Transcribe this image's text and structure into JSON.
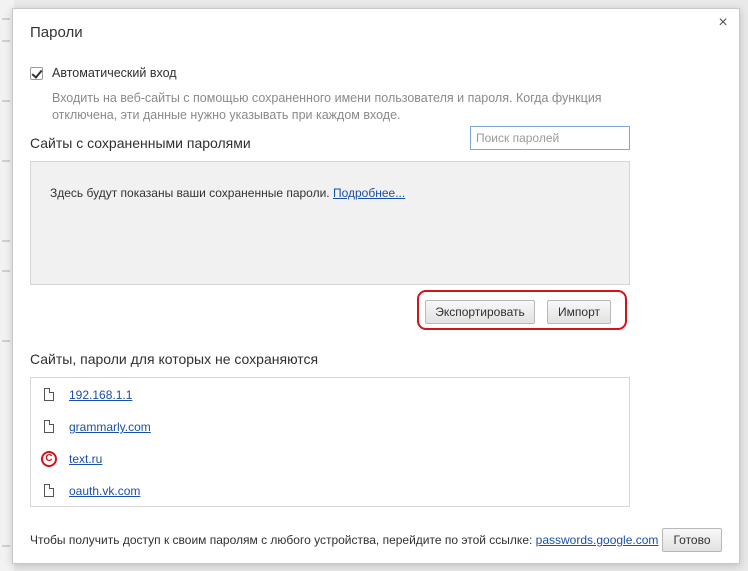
{
  "dialog": {
    "title": "Пароли",
    "close_glyph": "×"
  },
  "autologin": {
    "label": "Автоматический вход",
    "checked": true,
    "description": "Входить на веб-сайты с помощью сохраненного имени пользователя и пароля. Когда функция отключена, эти данные нужно указывать при каждом входе."
  },
  "saved": {
    "title": "Сайты с сохраненными паролями",
    "search_placeholder": "Поиск паролей",
    "empty_text": "Здесь будут показаны ваши сохраненные пароли.",
    "more_link": "Подробнее..."
  },
  "buttons": {
    "export": "Экспортировать",
    "import": "Импорт",
    "done": "Готово"
  },
  "highlight_color": "#d0141c",
  "exceptions": {
    "title": "Сайты, пароли для которых не сохраняются",
    "items": [
      {
        "site": "192.168.1.1",
        "icon": "page-icon"
      },
      {
        "site": "grammarly.com",
        "icon": "page-icon"
      },
      {
        "site": "text.ru",
        "icon": "copyright-icon"
      },
      {
        "site": "oauth.vk.com",
        "icon": "page-icon"
      }
    ]
  },
  "footer": {
    "text": "Чтобы получить доступ к своим паролям с любого устройства, перейдите по этой ссылке:",
    "link": "passwords.google.com"
  }
}
